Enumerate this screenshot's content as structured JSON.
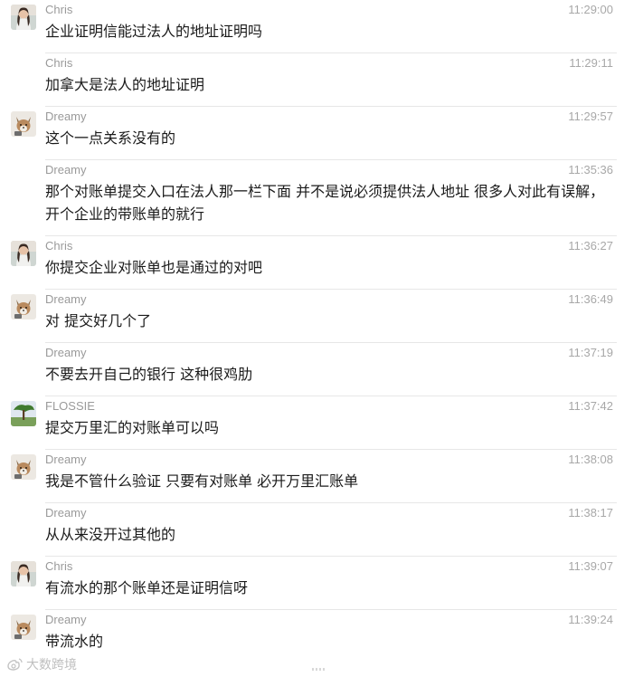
{
  "messages": [
    {
      "sender": "Chris",
      "time": "11:29:00",
      "text": "企业证明信能过法人的地址证明吗",
      "avatar": "chris-avatar"
    },
    {
      "sender": "Chris",
      "time": "11:29:11",
      "text": "加拿大是法人的地址证明",
      "avatar": null
    },
    {
      "sender": "Dreamy",
      "time": "11:29:57",
      "text": "这个一点关系没有的",
      "avatar": "dreamy-avatar"
    },
    {
      "sender": "Dreamy",
      "time": "11:35:36",
      "text": "那个对账单提交入口在法人那一栏下面   并不是说必须提供法人地址  很多人对此有误解，开个企业的带账单的就行",
      "avatar": null
    },
    {
      "sender": "Chris",
      "time": "11:36:27",
      "text": "你提交企业对账单也是通过的对吧",
      "avatar": "chris-avatar"
    },
    {
      "sender": "Dreamy",
      "time": "11:36:49",
      "text": "对 提交好几个了",
      "avatar": "dreamy-avatar"
    },
    {
      "sender": "Dreamy",
      "time": "11:37:19",
      "text": "不要去开自己的银行  这种很鸡肋",
      "avatar": null
    },
    {
      "sender": "FLOSSIE",
      "time": "11:37:42",
      "text": "提交万里汇的对账单可以吗",
      "avatar": "flossie-avatar"
    },
    {
      "sender": "Dreamy",
      "time": "11:38:08",
      "text": "我是不管什么验证 只要有对账单  必开万里汇账单",
      "avatar": "dreamy-avatar"
    },
    {
      "sender": "Dreamy",
      "time": "11:38:17",
      "text": "从从来没开过其他的",
      "avatar": null
    },
    {
      "sender": "Chris",
      "time": "11:39:07",
      "text": "有流水的那个账单还是证明信呀",
      "avatar": "chris-avatar"
    },
    {
      "sender": "Dreamy",
      "time": "11:39:24",
      "text": "带流水的",
      "avatar": "dreamy-avatar"
    }
  ],
  "watermark": {
    "text": "大数跨境"
  }
}
